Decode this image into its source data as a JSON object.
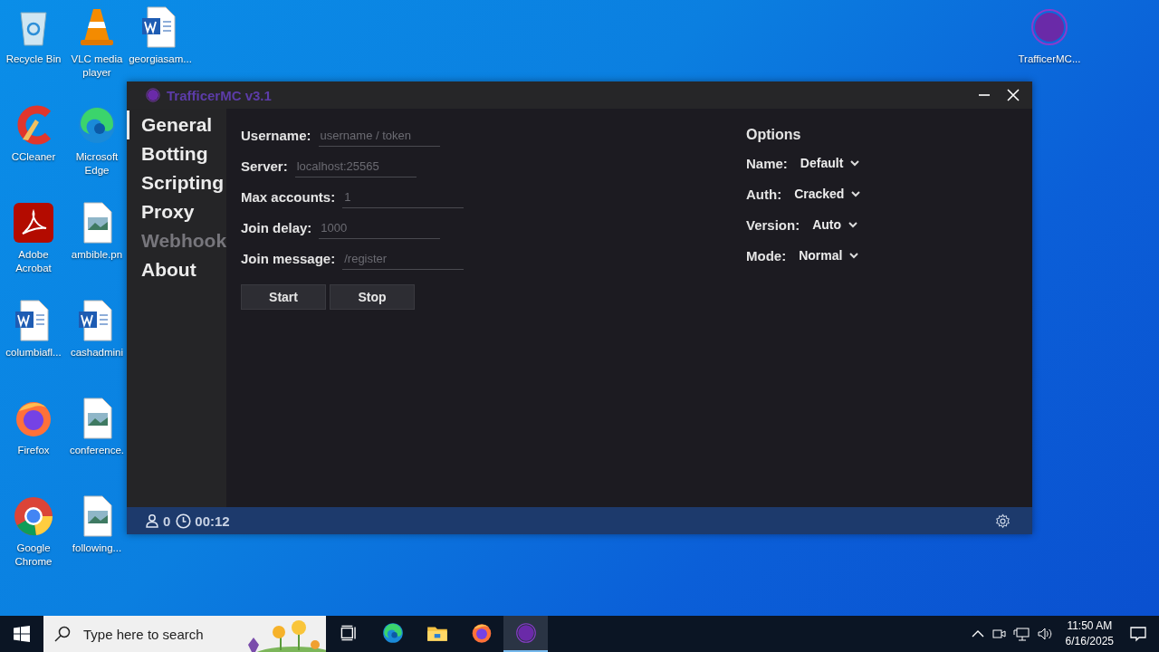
{
  "desktop_icons": [
    {
      "label": "Recycle Bin",
      "kind": "recycle"
    },
    {
      "label": "CCleaner",
      "kind": "ccleaner"
    },
    {
      "label": "Adobe Acrobat",
      "kind": "acrobat"
    },
    {
      "label": "columbiafl...",
      "kind": "word"
    },
    {
      "label": "Firefox",
      "kind": "firefox"
    },
    {
      "label": "Google Chrome",
      "kind": "chrome"
    },
    {
      "label": "VLC media player",
      "kind": "vlc"
    },
    {
      "label": "Microsoft Edge",
      "kind": "edge"
    },
    {
      "label": "ambible.pn",
      "kind": "image"
    },
    {
      "label": "cashadmini",
      "kind": "word"
    },
    {
      "label": "conference.",
      "kind": "image"
    },
    {
      "label": "following...",
      "kind": "image"
    },
    {
      "label": "georgiasam...",
      "kind": "word"
    }
  ],
  "desktop_right_icon": {
    "label": "TrafficerMC...",
    "kind": "app"
  },
  "window": {
    "title": "TrafficerMC v3.1",
    "nav": [
      {
        "label": "General",
        "selected": true,
        "disabled": false
      },
      {
        "label": "Botting",
        "selected": false,
        "disabled": false
      },
      {
        "label": "Scripting",
        "selected": false,
        "disabled": false
      },
      {
        "label": "Proxy",
        "selected": false,
        "disabled": false
      },
      {
        "label": "Webhook",
        "selected": false,
        "disabled": true
      },
      {
        "label": "About",
        "selected": false,
        "disabled": false
      }
    ],
    "fields": [
      {
        "label": "Username:",
        "placeholder": "username / token"
      },
      {
        "label": "Server:",
        "placeholder": "localhost:25565"
      },
      {
        "label": "Max accounts:",
        "placeholder": "1"
      },
      {
        "label": "Join delay:",
        "placeholder": "1000"
      },
      {
        "label": "Join message:",
        "placeholder": "/register"
      }
    ],
    "buttons": [
      "Start",
      "Stop"
    ],
    "options": {
      "title": "Options",
      "items": [
        {
          "label": "Name:",
          "value": "Default"
        },
        {
          "label": "Auth:",
          "value": "Cracked"
        },
        {
          "label": "Version:",
          "value": "Auto"
        },
        {
          "label": "Mode:",
          "value": "Normal"
        }
      ]
    },
    "status_bar": {
      "users": "0",
      "time": "00:12"
    }
  },
  "taskbar": {
    "search_placeholder": "Type here to search",
    "apps": [
      {
        "kind": "taskview",
        "active": false
      },
      {
        "kind": "edge",
        "active": false
      },
      {
        "kind": "folder",
        "active": false
      },
      {
        "kind": "firefox",
        "active": false
      },
      {
        "kind": "app",
        "active": true
      }
    ],
    "time": "11:50 AM",
    "date": "6/16/2025"
  }
}
